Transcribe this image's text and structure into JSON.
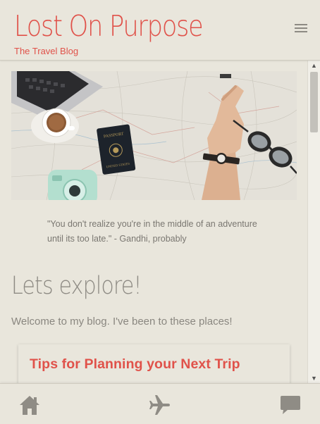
{
  "header": {
    "title": "Lost On Purpose",
    "subtitle": "The Travel Blog",
    "menu_icon": "hamburger-menu-icon"
  },
  "hero": {
    "alt": "desk with map, laptop, coffee, passport, camera and sunglasses"
  },
  "quote": {
    "text": "\"You don't realize you're in the middle of an adventure until its too late.\" - Gandhi, probably"
  },
  "section": {
    "title": "Lets explore!",
    "welcome": "Welcome to my blog. I've been to these places!"
  },
  "card": {
    "title": "Tips for Planning your Next Trip"
  },
  "bottom_nav": {
    "items": [
      {
        "icon": "home-icon"
      },
      {
        "icon": "airplane-icon"
      },
      {
        "icon": "chat-icon"
      }
    ]
  },
  "colors": {
    "accent": "#e0524a",
    "background": "#e9e6dc",
    "muted_text": "#8a8780"
  }
}
